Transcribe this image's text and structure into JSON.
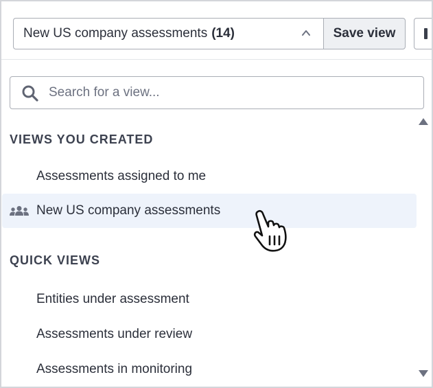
{
  "header": {
    "selected_view": "New US company assessments",
    "selected_count": "(14)",
    "save_label": "Save view"
  },
  "search": {
    "placeholder": "Search for a view..."
  },
  "sections": {
    "created": {
      "title": "VIEWS YOU CREATED",
      "items": [
        {
          "label": "Assessments assigned to me",
          "icon": ""
        },
        {
          "label": "New US company assessments",
          "icon": "group-icon"
        }
      ]
    },
    "quick": {
      "title": "QUICK VIEWS",
      "items": [
        {
          "label": "Entities under assessment"
        },
        {
          "label": "Assessments under review"
        },
        {
          "label": "Assessments in monitoring"
        }
      ]
    }
  },
  "icons": {
    "dropdown": "chevron-up-icon",
    "search": "search-icon",
    "cursor": "hand-pointer-icon"
  },
  "colors": {
    "active_row_bg": "#eef3fb",
    "text": "#2b2f3a"
  }
}
